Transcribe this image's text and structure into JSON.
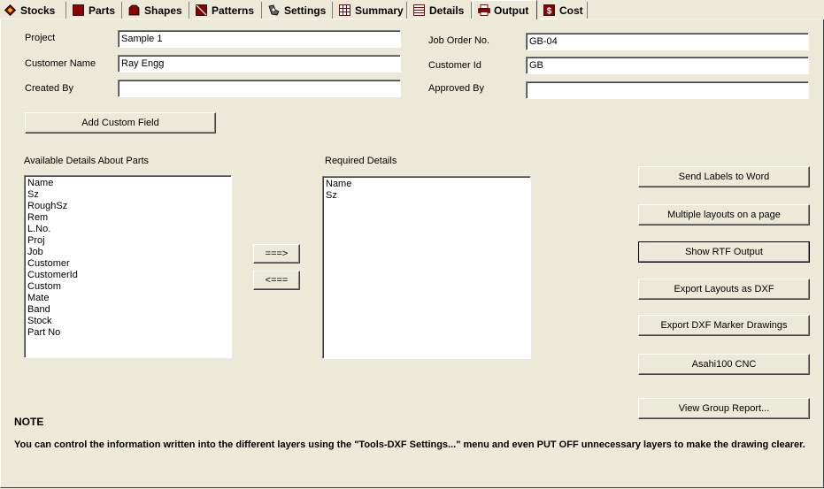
{
  "tabs": [
    {
      "label": "Stocks",
      "icon": "stocks-icon",
      "active": false
    },
    {
      "label": "Parts",
      "icon": "parts-icon",
      "active": false
    },
    {
      "label": "Shapes",
      "icon": "shapes-icon",
      "active": false
    },
    {
      "label": "Patterns",
      "icon": "patterns-icon",
      "active": false
    },
    {
      "label": "Settings",
      "icon": "settings-icon",
      "active": false
    },
    {
      "label": "Summary",
      "icon": "summary-icon",
      "active": false
    },
    {
      "label": "Details",
      "icon": "details-icon",
      "active": false
    },
    {
      "label": "Output",
      "icon": "printer-icon",
      "active": true
    },
    {
      "label": "Cost",
      "icon": "dollar-icon",
      "active": false
    }
  ],
  "form": {
    "project_label": "Project",
    "project_value": "Sample 1",
    "customer_name_label": "Customer Name",
    "customer_name_value": "Ray Engg",
    "created_by_label": "Created By",
    "created_by_value": "",
    "job_order_label": "Job Order No.",
    "job_order_value": "GB-04",
    "customer_id_label": "Customer Id",
    "customer_id_value": "GB",
    "approved_by_label": "Approved By",
    "approved_by_value": ""
  },
  "add_custom_field_label": "Add Custom Field",
  "available": {
    "label": "Available Details About Parts",
    "items": [
      "Name",
      "Sz",
      "RoughSz",
      "Rem",
      "L.No.",
      "Proj",
      "Job",
      "Customer",
      "CustomerId",
      "Custom",
      "Mate",
      "Band",
      "Stock",
      "Part No"
    ]
  },
  "required": {
    "label": "Required Details",
    "items": [
      "Name",
      "Sz"
    ]
  },
  "move_right_label": "===>",
  "move_left_label": "<===",
  "actions": {
    "send_labels": "Send Labels to Word",
    "multiple_layouts": "Multiple layouts on a page",
    "show_rtf": "Show RTF Output",
    "export_layouts_dxf": "Export Layouts as DXF",
    "export_dxf_marker": "Export DXF Marker Drawings",
    "asahi": "Asahi100 CNC",
    "view_group_report": "View Group Report..."
  },
  "note": {
    "title": "NOTE",
    "text": "You can control the information written into the different layers using the \"Tools-DXF Settings...\" menu and even PUT OFF unnecessary layers to make the drawing clearer."
  },
  "colors": {
    "accent": "#8b0000",
    "face": "#ece9d8"
  }
}
